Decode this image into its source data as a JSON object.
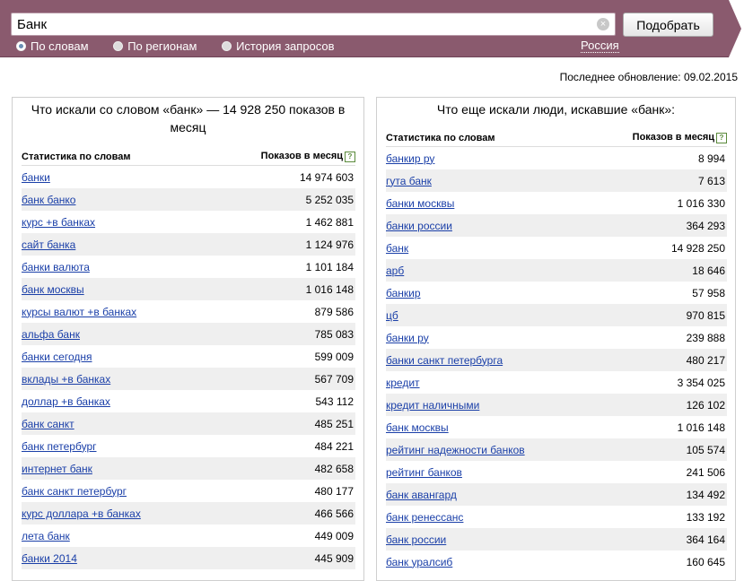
{
  "search": {
    "value": "Банк",
    "submit_label": "Подобрать"
  },
  "modes": [
    {
      "label": "По словам",
      "selected": true
    },
    {
      "label": "По регионам",
      "selected": false
    },
    {
      "label": "История запросов",
      "selected": false
    }
  ],
  "region": "Россия",
  "last_update": "Последнее обновление: 09.02.2015",
  "left": {
    "title": "Что искали со словом «банк» — 14 928 250 показов в месяц",
    "col_keyword": "Статистика по словам",
    "col_count": "Показов в месяц",
    "rows": [
      [
        "банки",
        "14 974 603"
      ],
      [
        "банк банко",
        "5 252 035"
      ],
      [
        "курс +в банках",
        "1 462 881"
      ],
      [
        "сайт банка",
        "1 124 976"
      ],
      [
        "банки валюта",
        "1 101 184"
      ],
      [
        "банк москвы",
        "1 016 148"
      ],
      [
        "курсы валют +в банках",
        "879 586"
      ],
      [
        "альфа банк",
        "785 083"
      ],
      [
        "банки сегодня",
        "599 009"
      ],
      [
        "вклады +в банках",
        "567 709"
      ],
      [
        "доллар +в банках",
        "543 112"
      ],
      [
        "банк санкт",
        "485 251"
      ],
      [
        "банк петербург",
        "484 221"
      ],
      [
        "интернет банк",
        "482 658"
      ],
      [
        "банк санкт петербург",
        "480 177"
      ],
      [
        "курс доллара +в банках",
        "466 566"
      ],
      [
        "лета банк",
        "449 009"
      ],
      [
        "банки 2014",
        "445 909"
      ]
    ]
  },
  "right": {
    "title": "Что еще искали люди, искавшие «банк»:",
    "col_keyword": "Статистика по словам",
    "col_count": "Показов в месяц",
    "rows": [
      [
        "банкир ру",
        "8 994"
      ],
      [
        "гута банк",
        "7 613"
      ],
      [
        "банки москвы",
        "1 016 330"
      ],
      [
        "банки россии",
        "364 293"
      ],
      [
        "банк",
        "14 928 250"
      ],
      [
        "арб",
        "18 646"
      ],
      [
        "банкир",
        "57 958"
      ],
      [
        "цб",
        "970 815"
      ],
      [
        "банки ру",
        "239 888"
      ],
      [
        "банки санкт петербурга",
        "480 217"
      ],
      [
        "кредит",
        "3 354 025"
      ],
      [
        "кредит наличными",
        "126 102"
      ],
      [
        "банк москвы",
        "1 016 148"
      ],
      [
        "рейтинг надежности банков",
        "105 574"
      ],
      [
        "рейтинг банков",
        "241 506"
      ],
      [
        "банк авангард",
        "134 492"
      ],
      [
        "банк ренессанс",
        "133 192"
      ],
      [
        "банк россии",
        "364 164"
      ],
      [
        "банк уралсиб",
        "160 645"
      ]
    ]
  },
  "colors": {
    "header": "#8a5a6e",
    "link": "#1a3fa8",
    "row_alt": "#efefef"
  }
}
